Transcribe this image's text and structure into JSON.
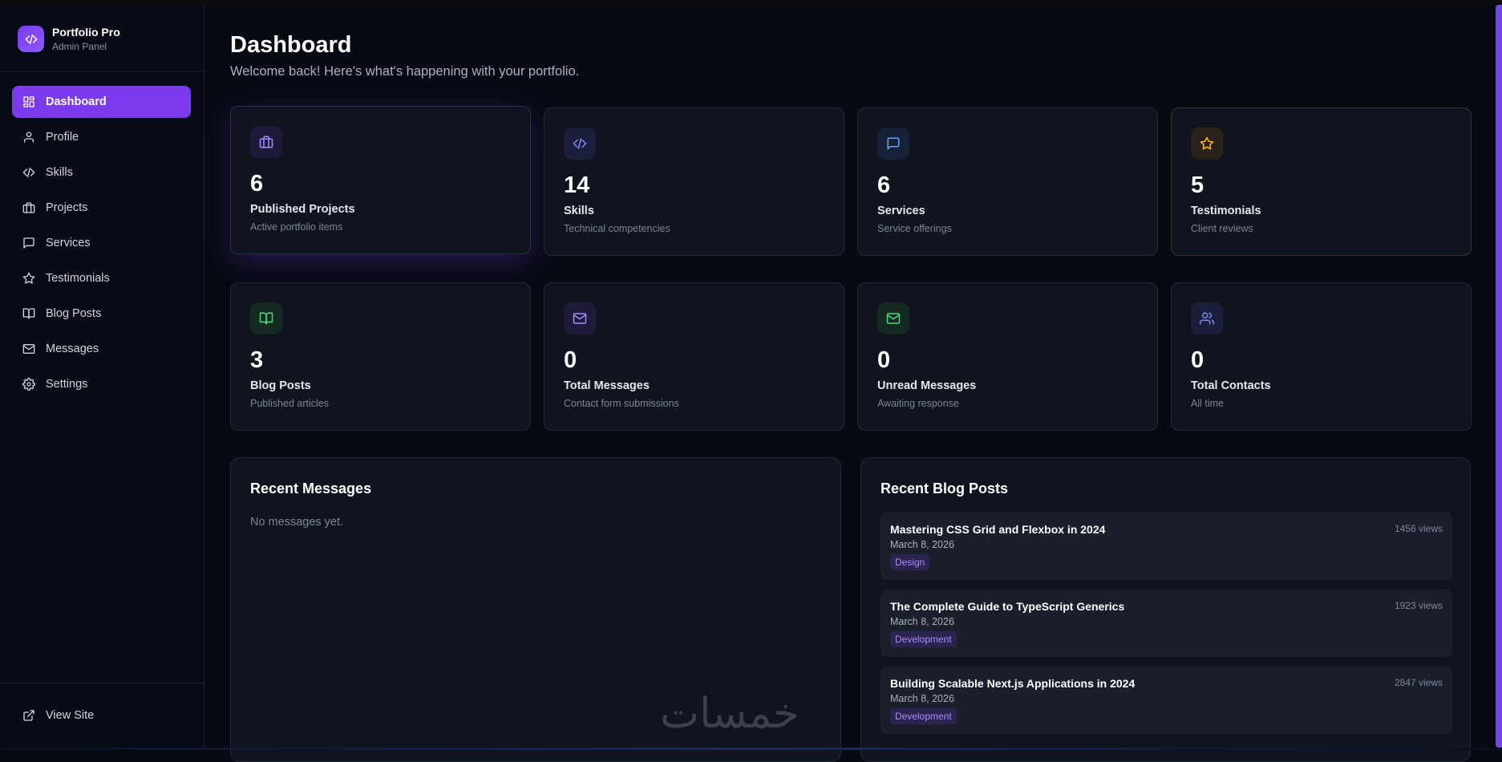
{
  "brand": {
    "title": "Portfolio Pro",
    "subtitle": "Admin Panel"
  },
  "sidebar": {
    "items": [
      {
        "label": "Dashboard",
        "icon": "grid-icon",
        "active": true
      },
      {
        "label": "Profile",
        "icon": "user-icon"
      },
      {
        "label": "Skills",
        "icon": "code-icon"
      },
      {
        "label": "Projects",
        "icon": "briefcase-icon"
      },
      {
        "label": "Services",
        "icon": "message-square-icon"
      },
      {
        "label": "Testimonials",
        "icon": "star-icon"
      },
      {
        "label": "Blog Posts",
        "icon": "book-open-icon"
      },
      {
        "label": "Messages",
        "icon": "mail-icon"
      },
      {
        "label": "Settings",
        "icon": "gear-icon"
      }
    ],
    "view_site": "View Site"
  },
  "header": {
    "title": "Dashboard",
    "subtitle": "Welcome back! Here's what's happening with your portfolio."
  },
  "stats": [
    {
      "value": "6",
      "label": "Published Projects",
      "desc": "Active portfolio items",
      "icon": "briefcase-icon",
      "color": "#a78bfa"
    },
    {
      "value": "14",
      "label": "Skills",
      "desc": "Technical competencies",
      "icon": "code-icon",
      "color": "#818cf8"
    },
    {
      "value": "6",
      "label": "Services",
      "desc": "Service offerings",
      "icon": "message-square-icon",
      "color": "#60a5fa"
    },
    {
      "value": "5",
      "label": "Testimonials",
      "desc": "Client reviews",
      "icon": "star-icon",
      "color": "#fbbf24"
    },
    {
      "value": "3",
      "label": "Blog Posts",
      "desc": "Published articles",
      "icon": "book-open-icon",
      "color": "#4ade80"
    },
    {
      "value": "0",
      "label": "Total Messages",
      "desc": "Contact form submissions",
      "icon": "mail-icon",
      "color": "#a78bfa"
    },
    {
      "value": "0",
      "label": "Unread Messages",
      "desc": "Awaiting response",
      "icon": "mail-icon",
      "color": "#4ade80"
    },
    {
      "value": "0",
      "label": "Total Contacts",
      "desc": "All time",
      "icon": "users-icon",
      "color": "#818cf8"
    }
  ],
  "recent_messages": {
    "title": "Recent Messages",
    "empty": "No messages yet."
  },
  "recent_posts": {
    "title": "Recent Blog Posts",
    "items": [
      {
        "title": "Mastering CSS Grid and Flexbox in 2024",
        "date": "March 8, 2026",
        "tag": "Design",
        "views": "1456 views"
      },
      {
        "title": "The Complete Guide to TypeScript Generics",
        "date": "March 8, 2026",
        "tag": "Development",
        "views": "1923 views"
      },
      {
        "title": "Building Scalable Next.js Applications in 2024",
        "date": "March 8, 2026",
        "tag": "Development",
        "views": "2847 views"
      }
    ]
  },
  "watermark": "خمسات"
}
